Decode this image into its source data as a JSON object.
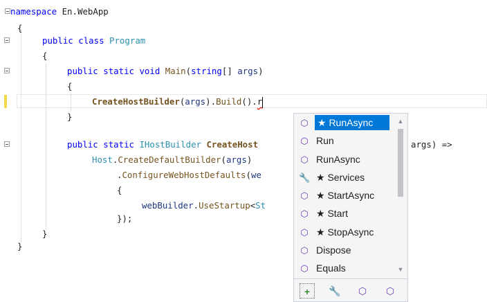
{
  "code": {
    "l1": {
      "kw": "namespace",
      "rest": " En.WebApp"
    },
    "l2": "{",
    "l3": {
      "kw1": "public",
      "kw2": "class",
      "cls": "Program"
    },
    "l4": "{",
    "l5": {
      "kw1": "public",
      "kw2": "static",
      "kw3": "void",
      "method": "Main",
      "open": "(",
      "kw4": "string",
      "rest": "[] ",
      "param": "args",
      "close": ")"
    },
    "l6": "{",
    "l7": {
      "method": "CreateHostBuilder",
      "open": "(",
      "param": "args",
      "mid": ").",
      "m2": "Build",
      "tail": "().",
      "typed": "r"
    },
    "l8": "}",
    "l9": {
      "kw1": "public",
      "kw2": "static",
      "type": "IHostBuilder",
      "method": "CreateHost",
      "tail": "args) =>"
    },
    "l10": {
      "type": "Host",
      "dot": ".",
      "method": "CreateDefaultBuilder",
      "open": "(",
      "param": "args",
      "close": ")"
    },
    "l11": {
      "dot": ".",
      "method": "ConfigureWebHostDefaults",
      "open": "(",
      "param": "we"
    },
    "l12": "{",
    "l13": {
      "param": "webBuilder",
      "dot": ".",
      "method": "UseStartup",
      "lt": "<",
      "type": "St"
    },
    "l14": "});",
    "l15": "}",
    "l16": "}"
  },
  "completion": {
    "items": [
      {
        "icon": "extension-method-icon",
        "label": "★ RunAsync",
        "selected": true
      },
      {
        "icon": "extension-method-icon",
        "label": "Run"
      },
      {
        "icon": "extension-method-icon",
        "label": "RunAsync"
      },
      {
        "icon": "wrench-icon",
        "label": "★ Services"
      },
      {
        "icon": "method-icon",
        "label": "★ StartAsync"
      },
      {
        "icon": "extension-method-icon",
        "label": "★ Start"
      },
      {
        "icon": "method-icon",
        "label": "★ StopAsync"
      },
      {
        "icon": "method-icon",
        "label": "Dispose"
      },
      {
        "icon": "method-icon",
        "label": "Equals"
      }
    ],
    "footer_filters": [
      "expand-items-icon",
      "wrench-icon",
      "method-icon",
      "extension-method-icon"
    ]
  },
  "colors": {
    "selection": "#0078d7",
    "keyword": "#0000ff",
    "type": "#2b91af",
    "method": "#74531f",
    "parameter": "#1f377f",
    "change_marker": "#f3d849"
  }
}
